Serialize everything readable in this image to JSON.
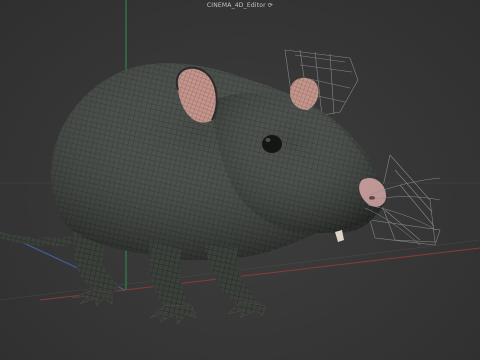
{
  "viewport": {
    "camera_label": "CINEMA_4D_Editor ⟳",
    "subject": "rat-mesh-wireframe",
    "colors": {
      "background": "#3a3a3a",
      "grid_line": "#555555",
      "x_axis": "#8a3a3a",
      "y_axis": "#2f8f4f",
      "z_axis": "#3f5f9f",
      "mesh_fill": "#3a3f3a",
      "mesh_wire": "#1e231e",
      "ear_inner": "#c99a90",
      "nose": "#d8a8a8",
      "cage_wire": "#9a9a9a"
    },
    "icons": {
      "rotate": "rotate-icon"
    }
  }
}
